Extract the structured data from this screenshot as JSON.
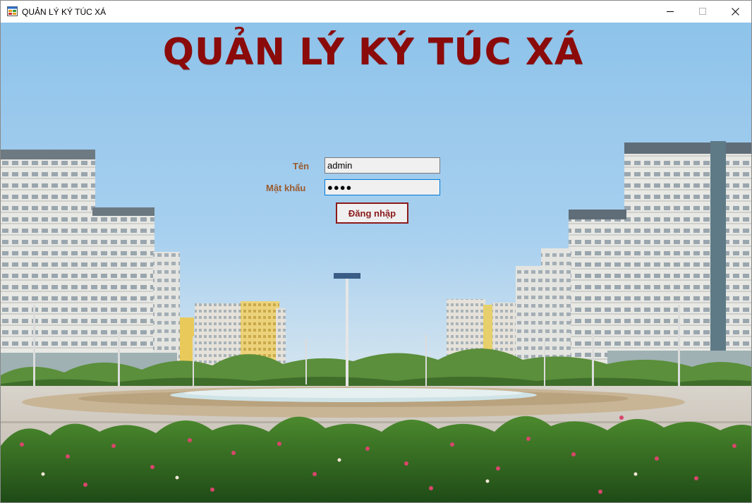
{
  "window": {
    "title": "QUẢN LÝ KÝ TÚC XÁ"
  },
  "header": {
    "title": "QUẢN LÝ KÝ TÚC XÁ"
  },
  "login": {
    "username_label": "Tên",
    "username_value": "admin",
    "password_label": "Mật khẩu",
    "password_value": "●●●●",
    "submit_label": "Đăng nhập"
  },
  "colors": {
    "title": "#8b0a0a",
    "label": "#9b5a2e",
    "button_border": "#8b1a1a",
    "focus_border": "#0078d7"
  },
  "icons": [
    "app-icon",
    "minimize-icon",
    "maximize-icon",
    "close-icon"
  ]
}
